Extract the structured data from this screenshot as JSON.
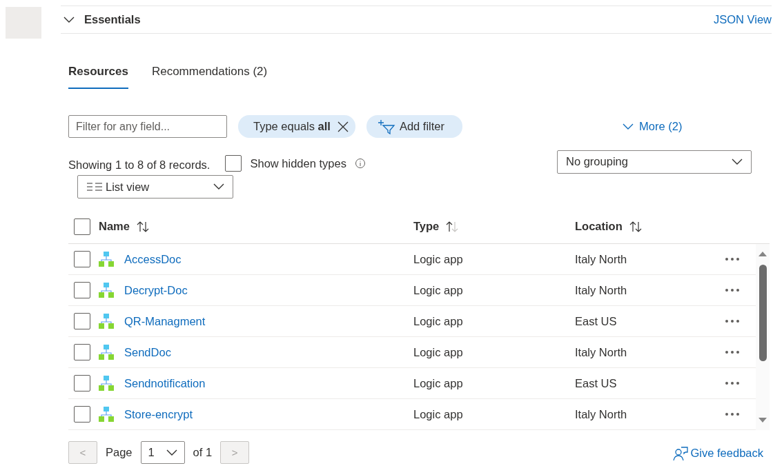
{
  "essentials": {
    "title": "Essentials",
    "expanded": true,
    "link": "JSON View"
  },
  "tabs": [
    {
      "label": "Resources",
      "selected": true
    },
    {
      "label": "Recommendations (2)",
      "selected": false
    }
  ],
  "filter": {
    "placeholder": "Filter for any field..."
  },
  "type_pill": "Type equals **all**",
  "add_filter": "Add filter",
  "more": "More (2)",
  "record_count": "Showing 1 to 8 of 8 records.",
  "show_hidden": {
    "label": "Show hidden types",
    "checked": false
  },
  "grouping": "No grouping",
  "view": "List view",
  "table": {
    "columns": [
      "Name",
      "Type",
      "Location"
    ],
    "all_checked": false,
    "rows": [
      {
        "name": "AccessDoc",
        "type": "Logic app",
        "location": "Italy North",
        "checked": false
      },
      {
        "name": "Decrypt-Doc",
        "type": "Logic app",
        "location": "Italy North",
        "checked": false
      },
      {
        "name": "QR-Managment",
        "type": "Logic app",
        "location": "East US",
        "checked": false
      },
      {
        "name": "SendDoc",
        "type": "Logic app",
        "location": "Italy North",
        "checked": false
      },
      {
        "name": "Sendnotification",
        "type": "Logic app",
        "location": "East US",
        "checked": false
      },
      {
        "name": "Store-encrypt",
        "type": "Logic app",
        "location": "Italy North",
        "checked": false
      }
    ]
  },
  "pagination": {
    "previous": "<",
    "previous_disabled": true,
    "page_label": "Page",
    "page": "1",
    "of": "of 1",
    "next": ">",
    "next_disabled": true
  },
  "feedback": "Give feedback"
}
